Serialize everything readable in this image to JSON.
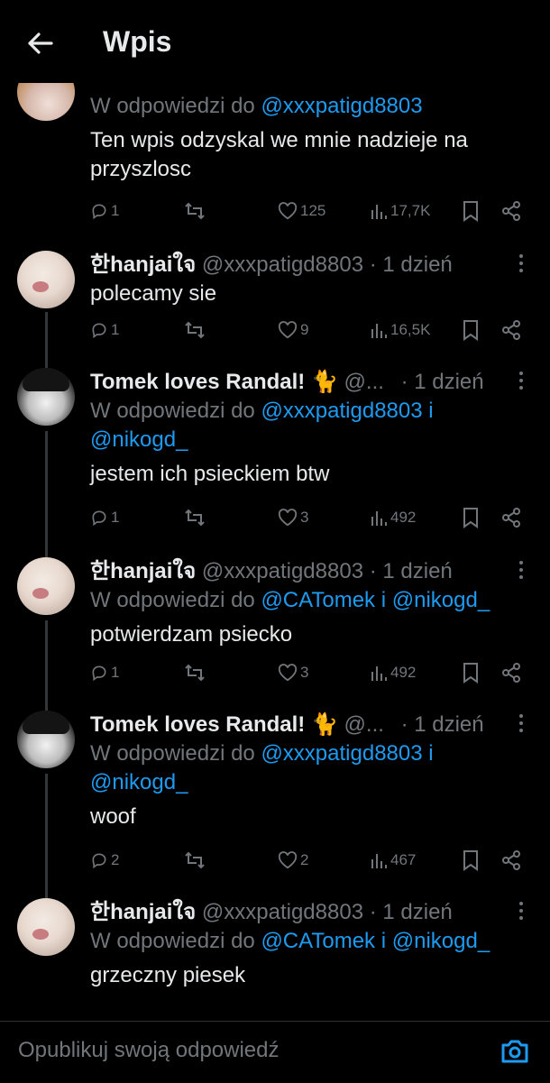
{
  "header": {
    "title": "Wpis"
  },
  "top_post": {
    "reply_prefix": "W odpowiedzi do",
    "mention": "@xxxpatigd8803",
    "text": "Ten wpis odzyskal we mnie nadzieje na przyszlosc",
    "replies": "1",
    "likes": "125",
    "views": "17,7K"
  },
  "posts": [
    {
      "name": "한hanjaiใจ",
      "handle": "@xxxpatigd8803",
      "time": "· 1 dzień",
      "text": "polecamy sie",
      "replies": "1",
      "likes": "9",
      "views": "16,5K"
    },
    {
      "name": "Tomek loves Randal!",
      "emoji": "🐈",
      "handle": "@...",
      "time": "· 1 dzień",
      "reply_prefix": "W odpowiedzi do",
      "mention1": "@xxxpatigd8803",
      "conj": "i",
      "mention2": "@nikogd_",
      "text": "jestem ich psieckiem btw",
      "replies": "1",
      "likes": "3",
      "views": "492"
    },
    {
      "name": "한hanjaiใจ",
      "handle": "@xxxpatigd8803",
      "time": "· 1 dzień",
      "reply_prefix": "W odpowiedzi do",
      "mention1": "@CATomek",
      "conj": "i",
      "mention2": "@nikogd_",
      "text": "potwierdzam psiecko",
      "replies": "1",
      "likes": "3",
      "views": "492"
    },
    {
      "name": "Tomek loves Randal!",
      "emoji": "🐈",
      "handle": "@...",
      "time": "· 1 dzień",
      "reply_prefix": "W odpowiedzi do",
      "mention1": "@xxxpatigd8803",
      "conj": "i",
      "mention2": "@nikogd_",
      "text": "woof",
      "replies": "2",
      "likes": "2",
      "views": "467"
    },
    {
      "name": "한hanjaiใจ",
      "handle": "@xxxpatigd8803",
      "time": "· 1 dzień",
      "reply_prefix": "W odpowiedzi do",
      "mention1": "@CATomek",
      "conj": "i",
      "mention2": "@nikogd_",
      "text": "grzeczny piesek"
    }
  ],
  "compose": {
    "placeholder": "Opublikuj swoją odpowiedź"
  },
  "colors": {
    "background": "#000000",
    "accent": "#1d9bf0",
    "muted": "#71767b",
    "text": "#e7e9ea"
  }
}
